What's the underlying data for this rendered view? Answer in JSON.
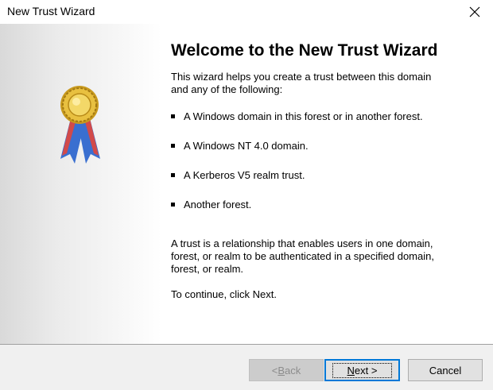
{
  "window": {
    "title": "New Trust Wizard",
    "close_icon": "close-icon"
  },
  "side_panel": {
    "icon": "award-ribbon-icon"
  },
  "main": {
    "heading": "Welcome to the New Trust Wizard",
    "intro": "This wizard helps you create a trust between this domain and any of the following:",
    "bullets": [
      "A Windows domain in this forest or in another forest.",
      "A Windows NT 4.0 domain.",
      "A Kerberos V5 realm trust.",
      "Another forest."
    ],
    "description": "A trust is a relationship that enables users in one domain, forest, or realm to be authenticated in a specified domain, forest, or realm.",
    "continue_text": "To continue, click Next."
  },
  "buttons": {
    "back": {
      "prefix": "< ",
      "accel": "B",
      "rest": "ack",
      "enabled": false
    },
    "next": {
      "accel": "N",
      "rest": "ext >"
    },
    "cancel": "Cancel"
  },
  "colors": {
    "focus_border": "#0078d7",
    "footer_bg": "#f0f0f0",
    "disabled_text": "#8c8c8c"
  }
}
